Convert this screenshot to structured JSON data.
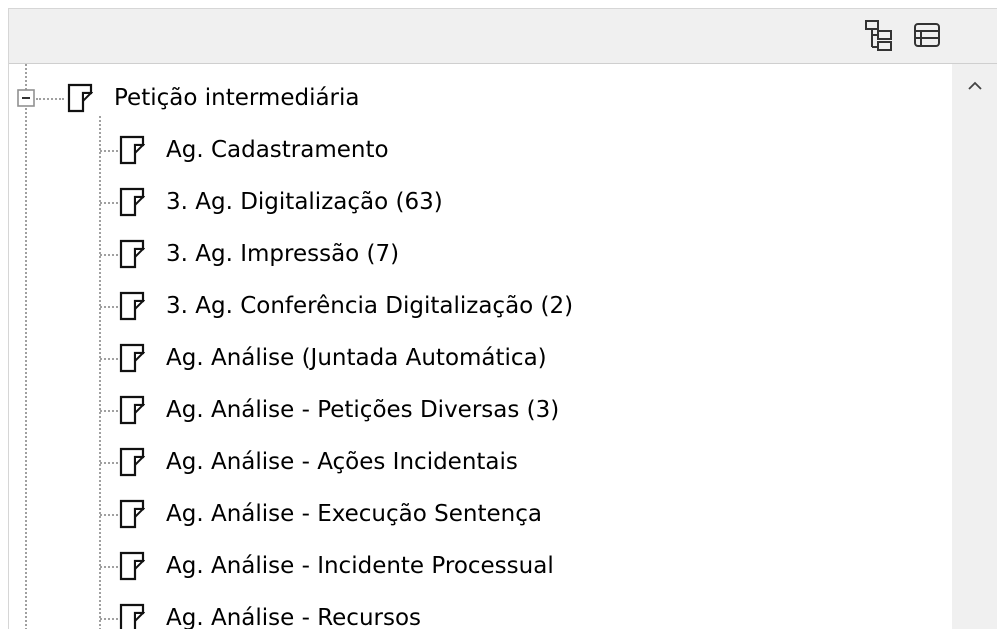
{
  "toolbar": {
    "expand_all_icon": "expand-all-icon",
    "collapse_all_icon": "collapse-all-icon"
  },
  "tree": {
    "root": {
      "label": "Petição intermediária",
      "expanded": true,
      "children": [
        {
          "label": "Ag. Cadastramento"
        },
        {
          "label": "3. Ag. Digitalização (63)"
        },
        {
          "label": "3. Ag. Impressão (7)"
        },
        {
          "label": "3. Ag. Conferência Digitalização (2)"
        },
        {
          "label": "Ag. Análise (Juntada Automática)"
        },
        {
          "label": "Ag. Análise - Petições Diversas (3)"
        },
        {
          "label": "Ag. Análise - Ações Incidentais"
        },
        {
          "label": "Ag. Análise - Execução Sentença"
        },
        {
          "label": "Ag. Análise - Incidente Processual"
        },
        {
          "label": "Ag. Análise - Recursos"
        }
      ]
    }
  },
  "scrollbar": {
    "up_icon": "chevron-up-icon"
  },
  "colors": {
    "panel_bg": "#f0f0f0",
    "tree_bg": "#ffffff",
    "guide_line": "#a0a0a0",
    "text": "#000000"
  }
}
